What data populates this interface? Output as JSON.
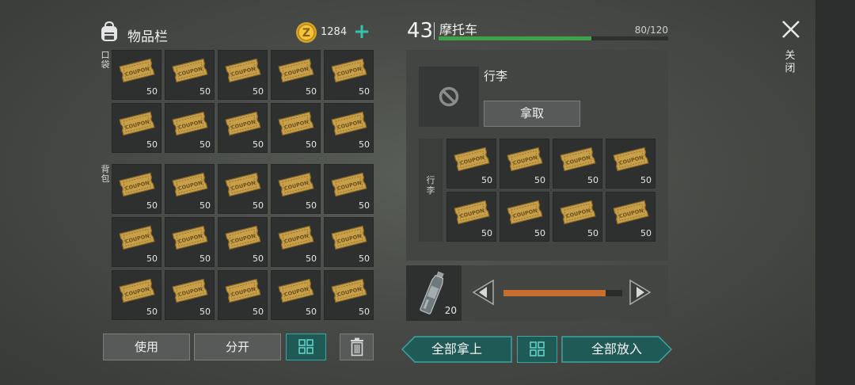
{
  "inventory": {
    "title": "物品栏",
    "coins": "1284",
    "pocket_label": "口袋",
    "backpack_label": "背包",
    "ticket_text": "COUPON",
    "pocket_slots": [
      "50",
      "50",
      "50",
      "50",
      "50",
      "50",
      "50",
      "50",
      "50",
      "50"
    ],
    "backpack_slots": [
      "50",
      "50",
      "50",
      "50",
      "50",
      "50",
      "50",
      "50",
      "50",
      "50",
      "50",
      "50",
      "50",
      "50",
      "50"
    ],
    "buttons": {
      "use": "使用",
      "split": "分开"
    }
  },
  "vehicle": {
    "level": "43",
    "name": "摩托车",
    "capacity_text": "80/120",
    "capacity_fraction": 0.6667,
    "luggage_title": "行李",
    "take_label": "拿取",
    "luggage_side_label": "行李",
    "luggage_slots": [
      "50",
      "50",
      "50",
      "50",
      "50",
      "50",
      "50",
      "50"
    ],
    "water_qty": "20",
    "slider_fraction": 0.86,
    "take_all_label": "全部拿上",
    "put_all_label": "全部放入"
  },
  "close_label": "关闭",
  "colors": {
    "accent_teal": "#33c3b0",
    "capacity_green": "#3fa34a",
    "slider_orange": "#c56f2c",
    "ticket_gold": "#c9a04a"
  },
  "icons": [
    "backpack-icon",
    "coin-icon",
    "plus-icon",
    "ticket-icon",
    "no-entry-icon",
    "water-bottle-icon",
    "arrow-left-icon",
    "arrow-right-icon",
    "grid-sort-icon",
    "trash-icon",
    "close-icon"
  ]
}
